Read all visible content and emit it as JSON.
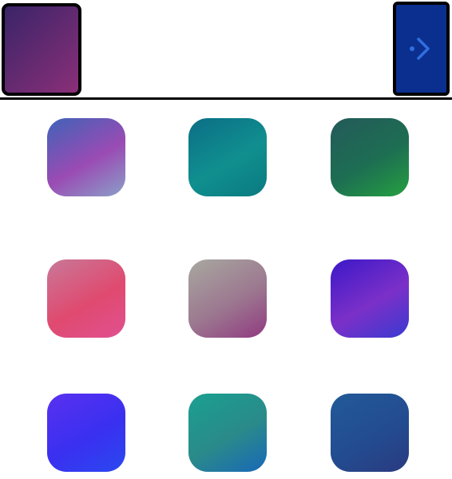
{
  "header": {
    "profile_tile": {
      "colors": [
        "#3a2468",
        "#8a2f78"
      ]
    },
    "next_button": {
      "icon": "chevron-right-icon",
      "bg": "#0b2f8f",
      "icon_color": "#2f6fe0"
    }
  },
  "tiles": [
    {
      "name": "tile-1",
      "colors": [
        "#3f63b8",
        "#9a4bb4",
        "#8aa0c8"
      ]
    },
    {
      "name": "tile-2",
      "colors": [
        "#0b6e86",
        "#108f8f",
        "#0a7a80"
      ]
    },
    {
      "name": "tile-3",
      "colors": [
        "#245a5a",
        "#1d6e52",
        "#25a040"
      ]
    },
    {
      "name": "tile-4",
      "colors": [
        "#c87898",
        "#e04a70",
        "#e05090"
      ]
    },
    {
      "name": "tile-5",
      "colors": [
        "#a8a8a0",
        "#9c7890",
        "#903a80"
      ]
    },
    {
      "name": "tile-6",
      "colors": [
        "#3b18c8",
        "#7b30c8",
        "#3a3ad0"
      ]
    },
    {
      "name": "tile-7",
      "colors": [
        "#5a30f0",
        "#3a30f0",
        "#2a48f0"
      ]
    },
    {
      "name": "tile-8",
      "colors": [
        "#1aa090",
        "#2a8a8a",
        "#1868b8"
      ]
    },
    {
      "name": "tile-9",
      "colors": [
        "#225a98",
        "#234c90",
        "#2a3a80"
      ]
    }
  ]
}
